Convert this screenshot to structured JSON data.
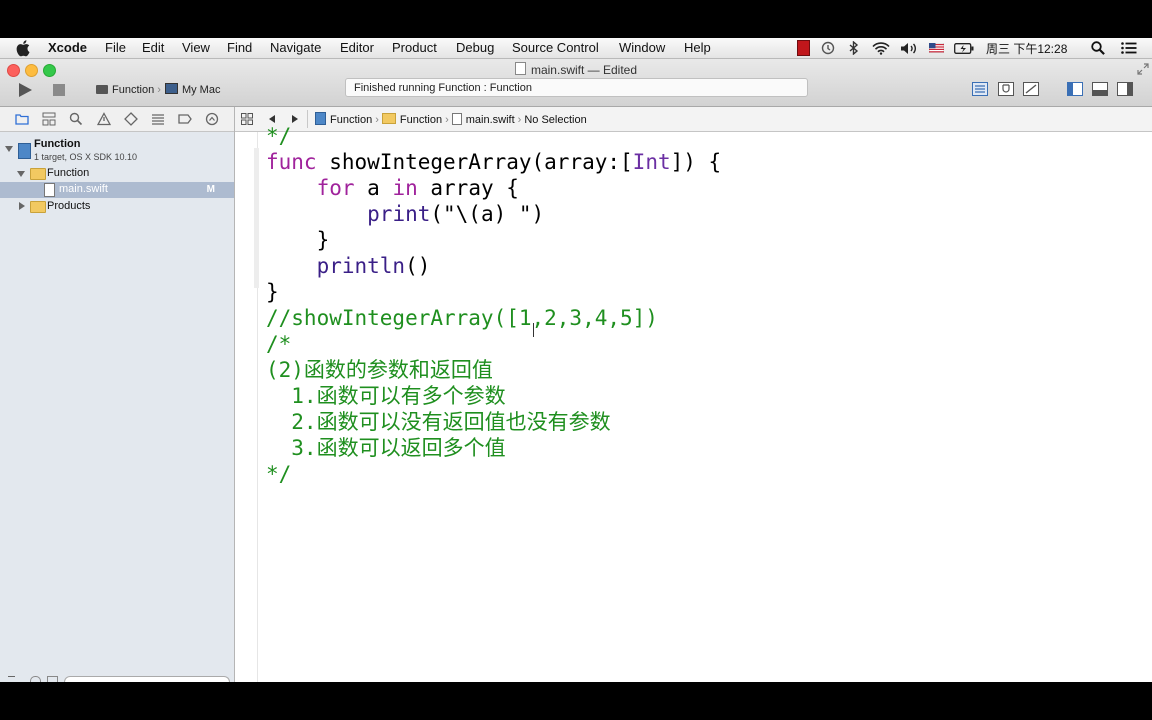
{
  "menubar": {
    "app": "Xcode",
    "items": [
      "File",
      "Edit",
      "View",
      "Find",
      "Navigate",
      "Editor",
      "Product",
      "Debug",
      "Source Control",
      "Window",
      "Help"
    ],
    "clock": "周三 下午12:28"
  },
  "window": {
    "title": "main.swift — Edited",
    "scheme_target": "Function",
    "scheme_device": "My Mac",
    "activity": "Finished running Function : Function"
  },
  "navigator": {
    "project_name": "Function",
    "project_subtitle": "1 target, OS X SDK 10.10",
    "group_name": "Function",
    "file_name": "main.swift",
    "file_badge": "M",
    "products_label": "Products"
  },
  "jumpbar": {
    "crumbs": [
      "Function",
      "Function",
      "main.swift",
      "No Selection"
    ]
  },
  "code": {
    "lines": [
      "*/",
      "func showIntegerArray(array:[Int]) {",
      "    for a in array {",
      "        print(\"\\(a) \")",
      "    }",
      "    println()",
      "}",
      "//showIntegerArray([1,2,3,4,5])",
      "/*",
      "(2)函数的参数和返回值",
      "  1.函数可以有多个参数",
      "  2.函数可以没有返回值也没有参数",
      "  3.函数可以返回多个值",
      "*/"
    ]
  },
  "colors": {
    "keyword": "#a0239c",
    "comment": "#1f8f1f",
    "selection": "#adbbd0"
  }
}
